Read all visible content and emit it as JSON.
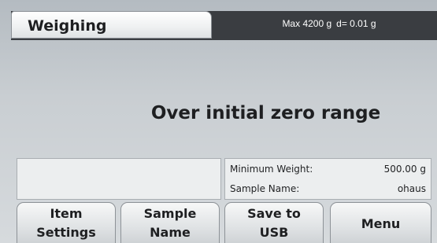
{
  "header": {
    "mode": "Weighing",
    "capacity": "Max 4200 g",
    "readability": "d= 0.01 g"
  },
  "status_message": "Over initial zero range",
  "info": {
    "minimum_weight_label": "Minimum Weight:",
    "minimum_weight_value": "500.00 g",
    "sample_name_label": "Sample Name:",
    "sample_name_value": "ohaus"
  },
  "softkeys": {
    "item_settings": [
      "Item",
      "Settings"
    ],
    "sample_name": [
      "Sample",
      "Name"
    ],
    "save_to_usb": [
      "Save to",
      "USB"
    ],
    "menu": "Menu"
  },
  "colors": {
    "header_bar": "#3a3d41",
    "background": "#c9ced2",
    "panel": "#eceeef"
  }
}
